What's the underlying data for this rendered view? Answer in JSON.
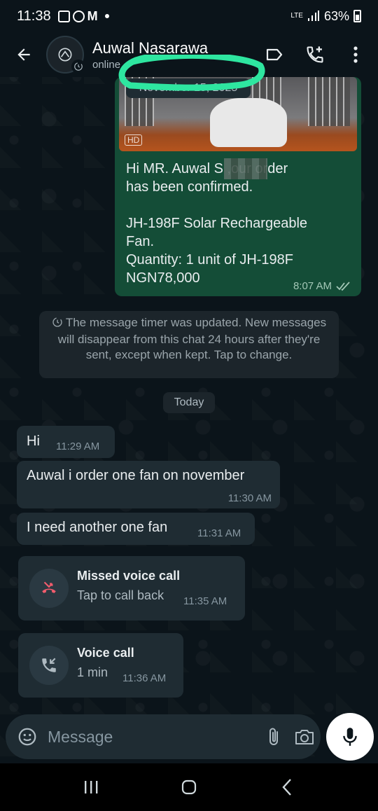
{
  "status_bar": {
    "time": "11:38",
    "network": "LTE",
    "battery": "63%"
  },
  "header": {
    "contact_name": "Auwal Nasarawa",
    "contact_status": "online"
  },
  "chat": {
    "outgoing_order": {
      "date_chip": "November 15, 2025",
      "image_badge": "HD",
      "text": "Hi MR. Auwal S        ,our order\nhas been confirmed.\n\nJH-198F Solar Rechargeable\nFan.\nQuantity: 1 unit of JH-198F\nNGN78,000",
      "time": "8:07 AM",
      "read_status": "read-ticks-icon"
    },
    "system_notice": "The message timer was updated. New messages will disappear from this chat 24 hours after they're sent, except when kept. Tap to change.",
    "day_separator": "Today",
    "incoming_messages": [
      {
        "text": "Hi",
        "time": "11:29 AM"
      },
      {
        "text": "Auwal i order one fan on november",
        "time": "11:30 AM"
      },
      {
        "text": "I need another one fan",
        "time": "11:31 AM"
      }
    ],
    "calls": [
      {
        "title": "Missed voice call",
        "subtitle": "Tap to call back",
        "time": "11:35 AM",
        "icon": "missed-call-icon",
        "accent": "#f15c6d"
      },
      {
        "title": "Voice call",
        "subtitle": "1 min",
        "time": "11:36 AM",
        "icon": "incoming-call-icon",
        "accent": "#aebac1"
      }
    ]
  },
  "composer": {
    "placeholder": "Message"
  },
  "colors": {
    "outgoing_bubble": "#144d37",
    "incoming_bubble": "#1f2c33",
    "background": "#0b141a",
    "highlight_marker": "#2ee6a0"
  }
}
